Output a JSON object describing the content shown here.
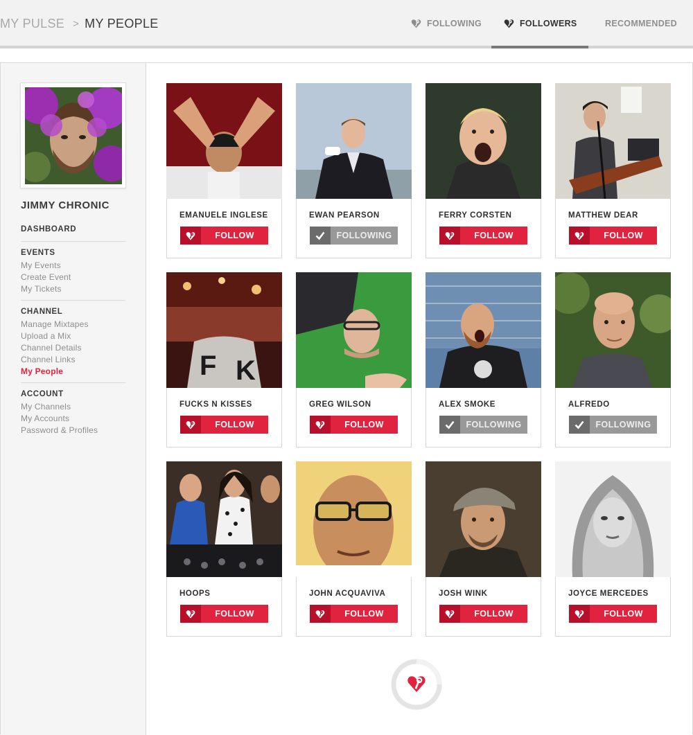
{
  "breadcrumb": {
    "parent": "MY PULSE",
    "separator": ">",
    "current": "MY PEOPLE"
  },
  "tabs": [
    {
      "label": "FOLLOWING",
      "icon": "heart-pin-icon",
      "active": false
    },
    {
      "label": "FOLLOWERS",
      "icon": "heart-pin-icon",
      "active": true
    },
    {
      "label": "RECOMMENDED",
      "active": false
    }
  ],
  "profile": {
    "name": "JIMMY CHRONIC",
    "avatar": "profile-photo"
  },
  "sidebar": {
    "dashboard": "DASHBOARD",
    "events": {
      "heading": "EVENTS",
      "items": [
        "My Events",
        "Create Event",
        "My Tickets"
      ]
    },
    "channel": {
      "heading": "CHANNEL",
      "items": [
        "Manage Mixtapes",
        "Upload a Mix",
        "Channel Details",
        "Channel Links",
        "My People"
      ],
      "active_item": "My People"
    },
    "account": {
      "heading": "ACCOUNT",
      "items": [
        "My Channels",
        "My Accounts",
        "Password & Profiles"
      ]
    }
  },
  "buttons": {
    "follow": "FOLLOW",
    "following": "FOLLOWING"
  },
  "people": [
    {
      "name": "EMANUELE INGLESE",
      "state": "follow",
      "label": "FOLLOW"
    },
    {
      "name": "EWAN PEARSON",
      "state": "following",
      "label": "FOLLOWING"
    },
    {
      "name": "FERRY CORSTEN",
      "state": "follow",
      "label": "FOLLOW"
    },
    {
      "name": "MATTHEW DEAR",
      "state": "follow",
      "label": "FOLLOW"
    },
    {
      "name": "FUCKS N KISSES",
      "state": "follow",
      "label": "FOLLOW"
    },
    {
      "name": "GREG WILSON",
      "state": "follow",
      "label": "FOLLOW"
    },
    {
      "name": "ALEX SMOKE",
      "state": "following",
      "label": "FOLLOWING"
    },
    {
      "name": "ALFREDO",
      "state": "following",
      "label": "FOLLOWING"
    },
    {
      "name": "HOOPS",
      "state": "follow",
      "label": "FOLLOW"
    },
    {
      "name": "JOHN ACQUAVIVA",
      "state": "follow",
      "label": "FOLLOW"
    },
    {
      "name": "JOSH WINK",
      "state": "follow",
      "label": "FOLLOW"
    },
    {
      "name": "JOYCE MERCEDES",
      "state": "follow",
      "label": "FOLLOW"
    }
  ],
  "colors": {
    "accent": "#e0233f",
    "accent_dark": "#b8102b",
    "following_gray": "#999999"
  },
  "loader": {
    "icon": "heart-pin-icon",
    "label": "loading-spinner"
  }
}
